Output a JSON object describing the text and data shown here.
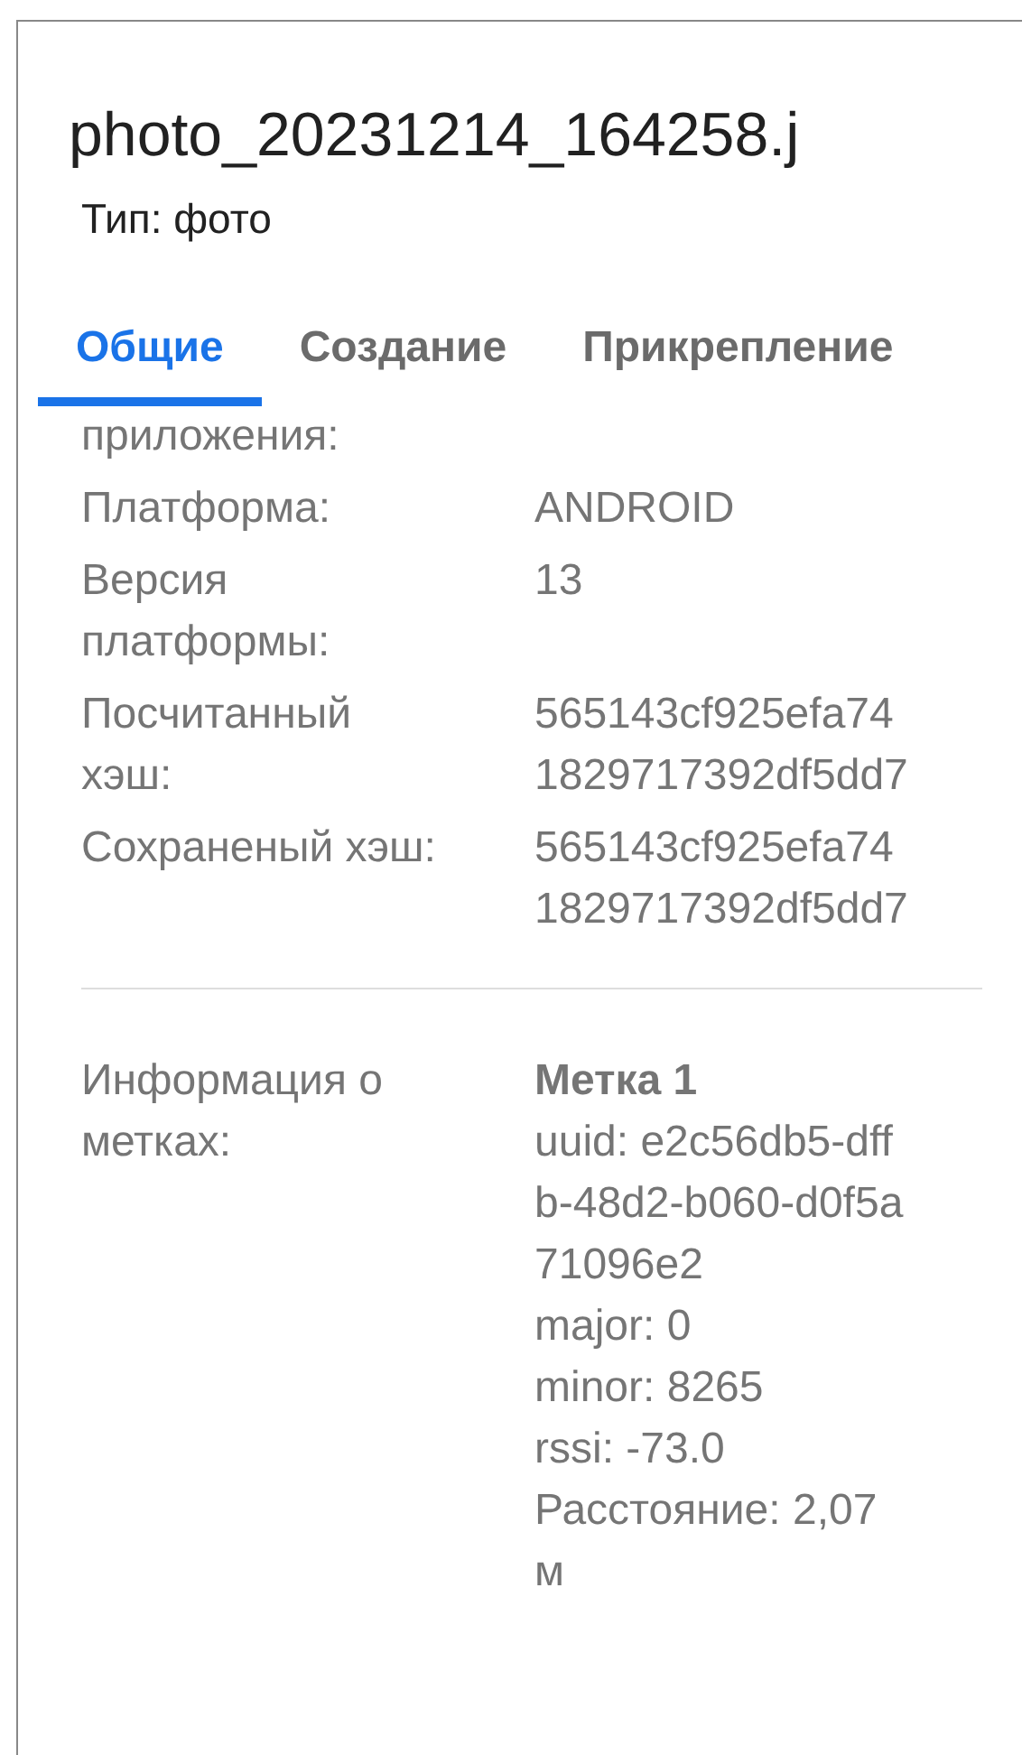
{
  "dialog": {
    "title": "photo_20231214_164258.j",
    "subtitle": "Тип: фото"
  },
  "tabs": [
    {
      "label": "Общие",
      "selected": true
    },
    {
      "label": "Создание",
      "selected": false
    },
    {
      "label": "Прикрепление",
      "selected": false
    }
  ],
  "properties": [
    {
      "label": "приложения:"
    },
    {
      "label": "Платформа:",
      "value_lines": [
        "ANDROID"
      ]
    },
    {
      "label": "Версия платформы:",
      "value_lines": [
        "13"
      ]
    },
    {
      "label": "Посчитанный хэш:",
      "value_lines": [
        "565143cf925efa74",
        "1829717392df5dd7"
      ]
    },
    {
      "label": "Сохраненый хэш:",
      "value_lines": [
        "565143cf925efa74",
        "1829717392df5dd7"
      ]
    }
  ],
  "tags_info": {
    "label": "Информация о метках:",
    "tag_title": "Метка 1",
    "lines": [
      "uuid: e2c56db5-dff",
      "b-48d2-b060-d0f5a",
      "71096e2",
      "major: 0",
      "minor: 8265",
      "rssi: -73.0",
      "Расстояние: 2,07",
      "м"
    ]
  }
}
